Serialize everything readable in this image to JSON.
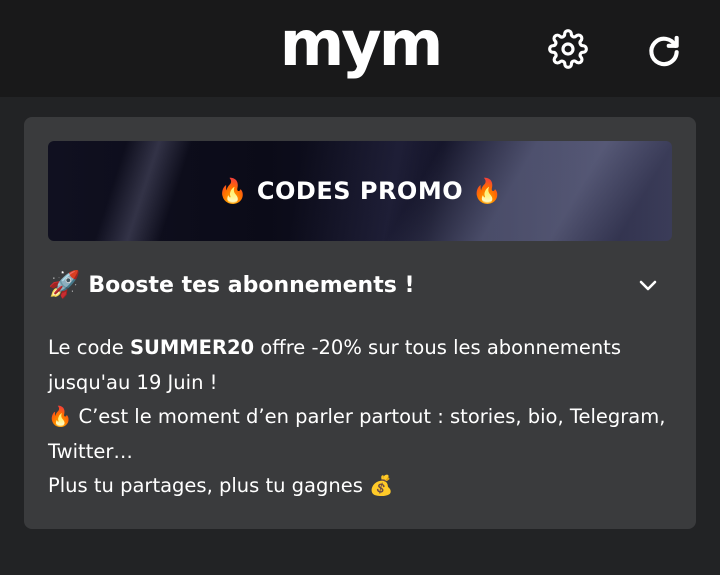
{
  "header": {
    "logo_text": "mym",
    "settings_icon": "gear-icon",
    "refresh_icon": "refresh-icon"
  },
  "banner": {
    "emoji_left": "🔥",
    "title": "CODES PROMO",
    "emoji_right": "🔥"
  },
  "section": {
    "icon": "🚀",
    "title": "Booste tes abonnements !",
    "chevron_icon": "chevron-down-icon",
    "expanded": true
  },
  "content": {
    "line1_prefix": "Le code ",
    "code": "SUMMER20",
    "line1_suffix": " offre -20% sur tous les abonnements jusqu'au 19 Juin !",
    "fire_emoji": "🔥",
    "line2": " C’est le moment d’en parler partout : stories, bio, Telegram, Twitter…",
    "line3": "Plus tu partages, plus tu gagnes ",
    "money_emoji": "💰"
  },
  "colors": {
    "topbar": "#19191a",
    "background": "#222325",
    "card": "#3a3b3d",
    "text": "#ffffff"
  }
}
